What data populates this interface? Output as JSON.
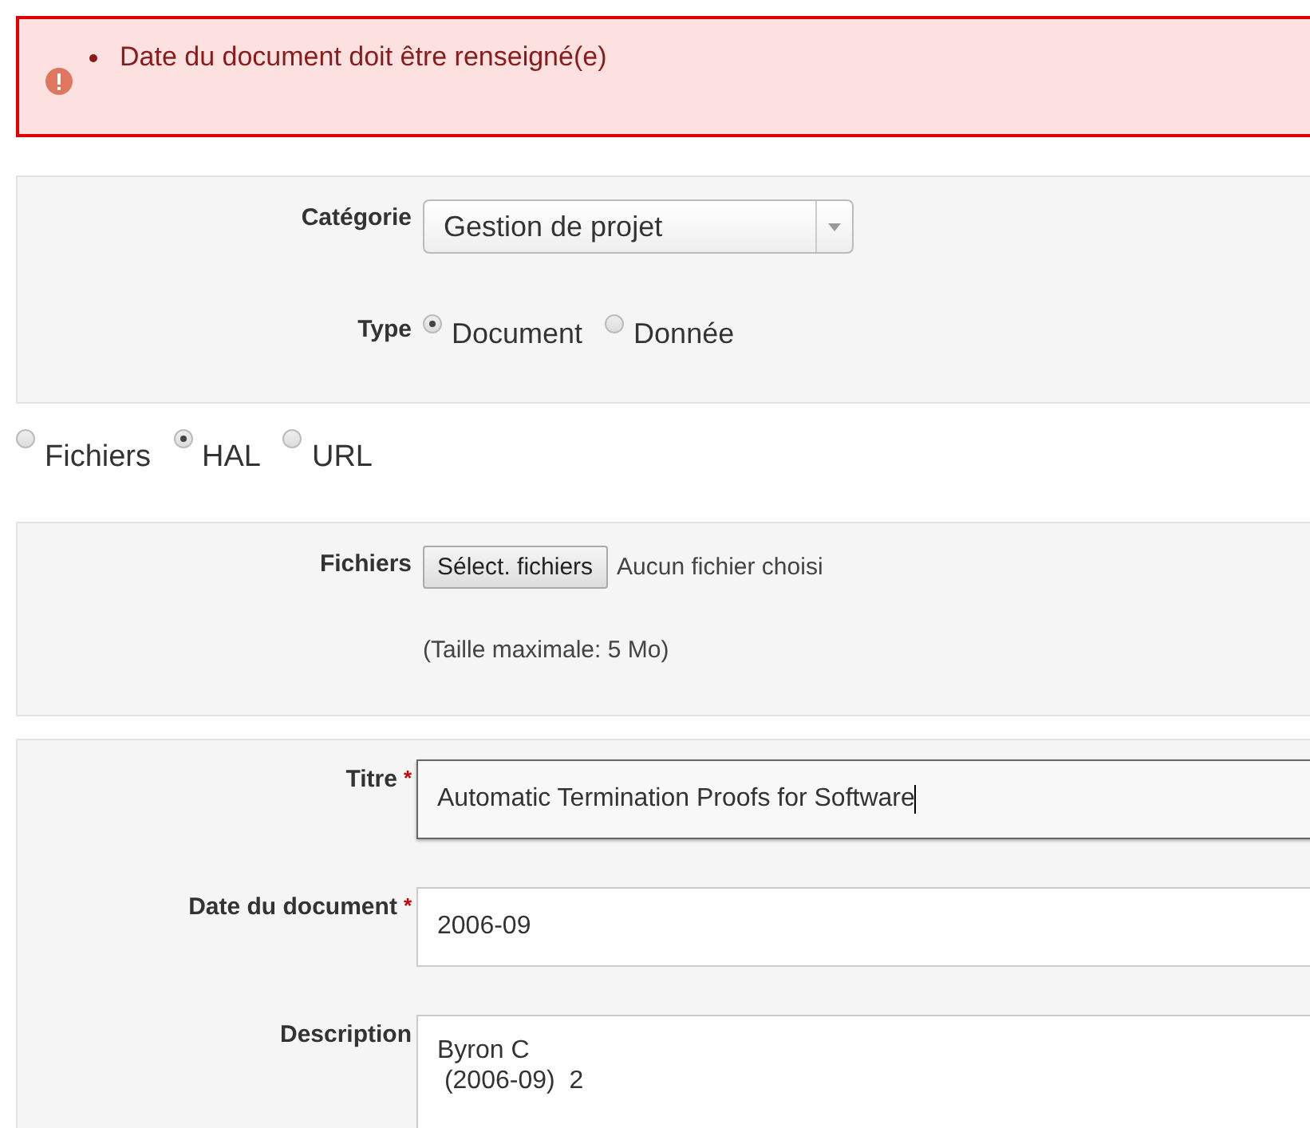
{
  "error_alert": {
    "messages": [
      "Date du document doit être renseigné(e)"
    ]
  },
  "classification": {
    "category": {
      "label": "Catégorie",
      "value": "Gestion de projet"
    },
    "type": {
      "label": "Type",
      "options": [
        {
          "label": "Document",
          "selected": true
        },
        {
          "label": "Donnée",
          "selected": false
        }
      ]
    }
  },
  "source_options": [
    {
      "label": "Fichiers",
      "selected": false
    },
    {
      "label": "HAL",
      "selected": true
    },
    {
      "label": "URL",
      "selected": false
    }
  ],
  "files": {
    "label": "Fichiers",
    "button": "Sélect. fichiers",
    "status": "Aucun fichier choisi",
    "hint": "(Taille maximale: 5 Mo)"
  },
  "metadata": [
    {
      "kind": "input",
      "label": "Titre",
      "required_mark": "*",
      "value": "Automatic Termination Proofs for Software",
      "focused": true
    },
    {
      "kind": "input",
      "label": "Date du document",
      "required_mark": "*",
      "value": "2006-09",
      "focused": false
    },
    {
      "kind": "textarea",
      "label": "Description",
      "value": "Byron C\n (2006-09)  2",
      "focused": false
    }
  ]
}
